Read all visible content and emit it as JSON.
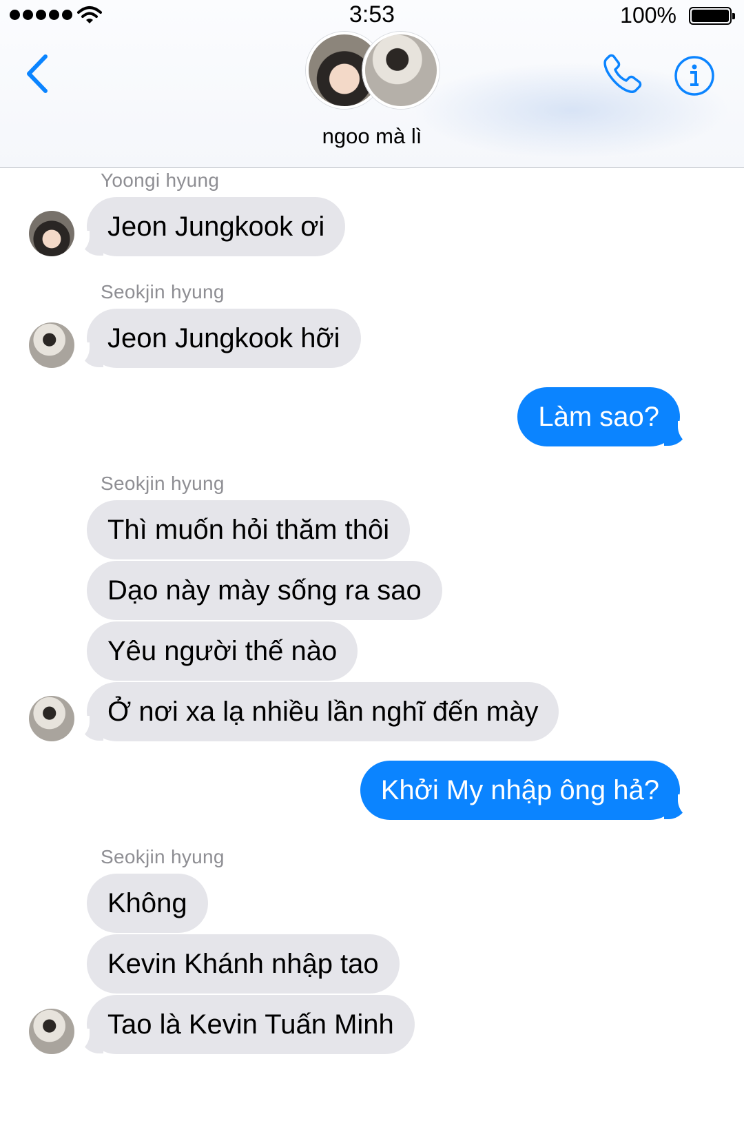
{
  "status_bar": {
    "time": "3:53",
    "battery": "100%"
  },
  "header": {
    "group_name": "ngoo mà lì",
    "icons": {
      "back": "chevron-left-icon",
      "call": "phone-icon",
      "info": "info-icon"
    },
    "accent_color": "#0b84ff"
  },
  "messages": [
    {
      "type": "sender",
      "text": "Yoongi hyung"
    },
    {
      "type": "in",
      "text": "Jeon Jungkook ơi"
    },
    {
      "type": "sender",
      "text": "Seokjin hyung"
    },
    {
      "type": "in",
      "text": "Jeon Jungkook hỡi"
    },
    {
      "type": "out",
      "text": "Làm sao?"
    },
    {
      "type": "sender",
      "text": "Seokjin hyung"
    },
    {
      "type": "in",
      "text": "Thì muốn hỏi thăm thôi"
    },
    {
      "type": "in",
      "text": "Dạo này mày sống ra sao"
    },
    {
      "type": "in",
      "text": "Yêu người thế nào"
    },
    {
      "type": "in",
      "text": "Ở nơi xa lạ nhiều lần nghĩ đến mày"
    },
    {
      "type": "out",
      "text": "Khởi My nhập ông hả?"
    },
    {
      "type": "sender",
      "text": "Seokjin hyung"
    },
    {
      "type": "in",
      "text": "Không"
    },
    {
      "type": "in",
      "text": "Kevin Khánh nhập tao"
    },
    {
      "type": "in",
      "text": "Tao là Kevin Tuấn Minh"
    }
  ],
  "colors": {
    "incoming_bubble": "#e5e5ea",
    "outgoing_bubble": "#0b84ff",
    "sender_label": "#8e8e93"
  }
}
